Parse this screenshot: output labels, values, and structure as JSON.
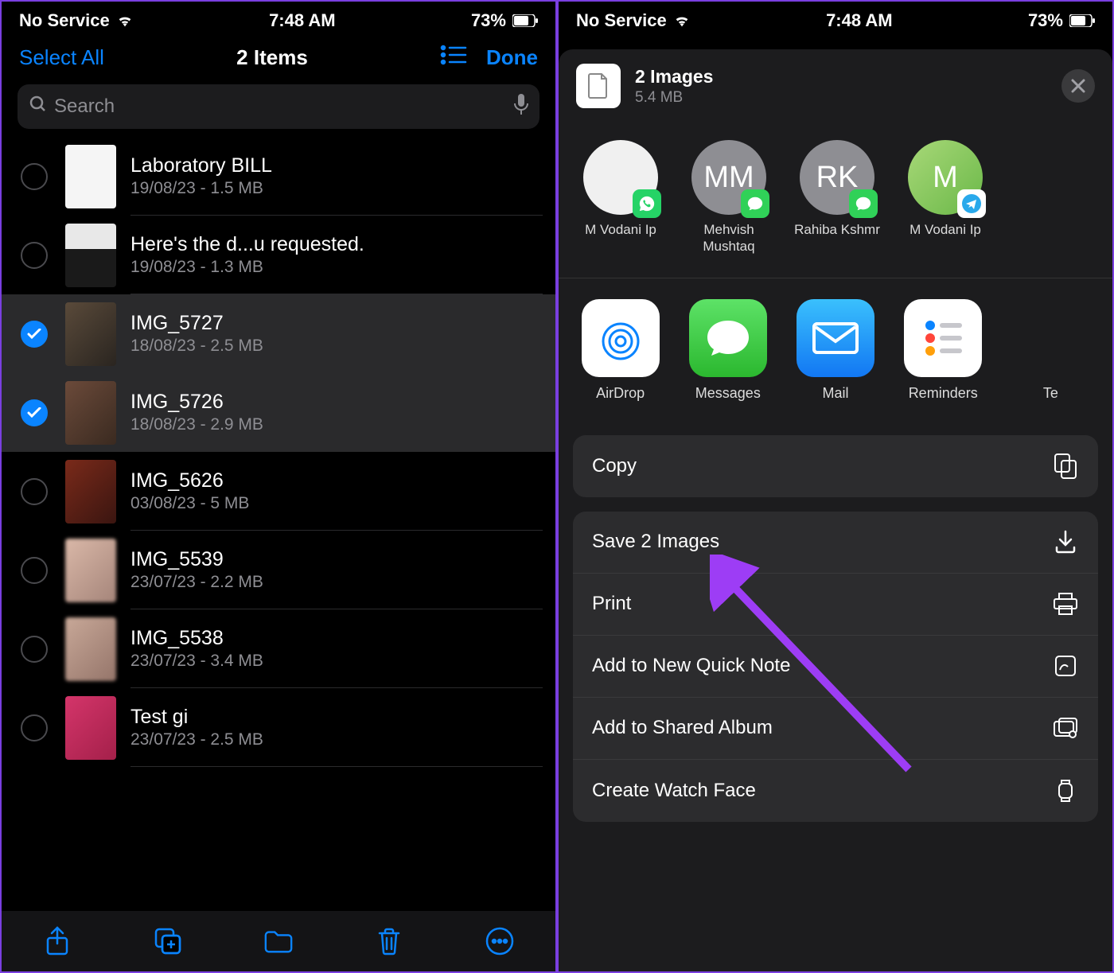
{
  "status": {
    "carrier": "No Service",
    "time": "7:48 AM",
    "battery": "73%"
  },
  "left": {
    "nav": {
      "select_all": "Select All",
      "title": "2 Items",
      "done": "Done"
    },
    "search_placeholder": "Search",
    "files": [
      {
        "name": "Laboratory BILL",
        "meta": "19/08/23 - 1.5 MB",
        "selected": false,
        "thumb": "doc"
      },
      {
        "name": "Here's the d...u requested.",
        "meta": "19/08/23 - 1.3 MB",
        "selected": false,
        "thumb": "doc2"
      },
      {
        "name": "IMG_5727",
        "meta": "18/08/23 - 2.5 MB",
        "selected": true,
        "thumb": "photo1"
      },
      {
        "name": "IMG_5726",
        "meta": "18/08/23 - 2.9 MB",
        "selected": true,
        "thumb": "photo2"
      },
      {
        "name": "IMG_5626",
        "meta": "03/08/23 - 5 MB",
        "selected": false,
        "thumb": "photo3"
      },
      {
        "name": "IMG_5539",
        "meta": "23/07/23 - 2.2 MB",
        "selected": false,
        "thumb": "photo4"
      },
      {
        "name": "IMG_5538",
        "meta": "23/07/23 - 3.4 MB",
        "selected": false,
        "thumb": "photo5"
      },
      {
        "name": "Test gi",
        "meta": "23/07/23 - 2.5 MB",
        "selected": false,
        "thumb": "photo6"
      }
    ]
  },
  "right": {
    "sheet": {
      "title": "2 Images",
      "subtitle": "5.4 MB"
    },
    "contacts": [
      {
        "name": "M Vodani Ip",
        "initials": "",
        "avatarClass": "white",
        "badge": "whatsapp"
      },
      {
        "name": "Mehvish Mushtaq",
        "initials": "MM",
        "avatarClass": "",
        "badge": "messages"
      },
      {
        "name": "Rahiba Kshmr",
        "initials": "RK",
        "avatarClass": "",
        "badge": "messages"
      },
      {
        "name": "M Vodani Ip",
        "initials": "M",
        "avatarClass": "green",
        "badge": "telegram"
      }
    ],
    "apps": [
      {
        "name": "AirDrop",
        "iconClass": "airdrop-icon"
      },
      {
        "name": "Messages",
        "iconClass": "messages-icon"
      },
      {
        "name": "Mail",
        "iconClass": "mail-icon"
      },
      {
        "name": "Reminders",
        "iconClass": "reminders-icon"
      },
      {
        "name": "Te",
        "iconClass": ""
      }
    ],
    "actions_primary": [
      {
        "label": "Copy",
        "icon": "copy"
      }
    ],
    "actions": [
      {
        "label": "Save 2 Images",
        "icon": "download"
      },
      {
        "label": "Print",
        "icon": "print"
      },
      {
        "label": "Add to New Quick Note",
        "icon": "note"
      },
      {
        "label": "Add to Shared Album",
        "icon": "album"
      },
      {
        "label": "Create Watch Face",
        "icon": "watch"
      }
    ]
  }
}
